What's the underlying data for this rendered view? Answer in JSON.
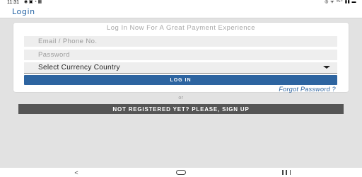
{
  "status_bar": {
    "time": "11:31",
    "left_icons": "◉ ▣ ◔ ▦",
    "right_icons": "◎ ᯤ ⁴ᴳ⁺ ▮▮ ▬"
  },
  "app_bar": {
    "title": "Login"
  },
  "form": {
    "heading": "Log In Now For A Great Payment Experience",
    "email_placeholder": "Email / Phone No.",
    "password_placeholder": "Password",
    "currency_select_value": "Select Currency Country",
    "login_label": "LOG IN",
    "forgot_password_label": "Forgot Password ?"
  },
  "divider_text": "or",
  "signup_label": "NOT REGISTERED YET? PLEASE, SIGN UP",
  "nav_bar": {
    "back_glyph": "<",
    "home_glyph": "",
    "recent_glyph": ""
  },
  "colors": {
    "accent": "#2d64a0",
    "signup_bg": "#555555",
    "page_bg": "#e2e2e2"
  }
}
